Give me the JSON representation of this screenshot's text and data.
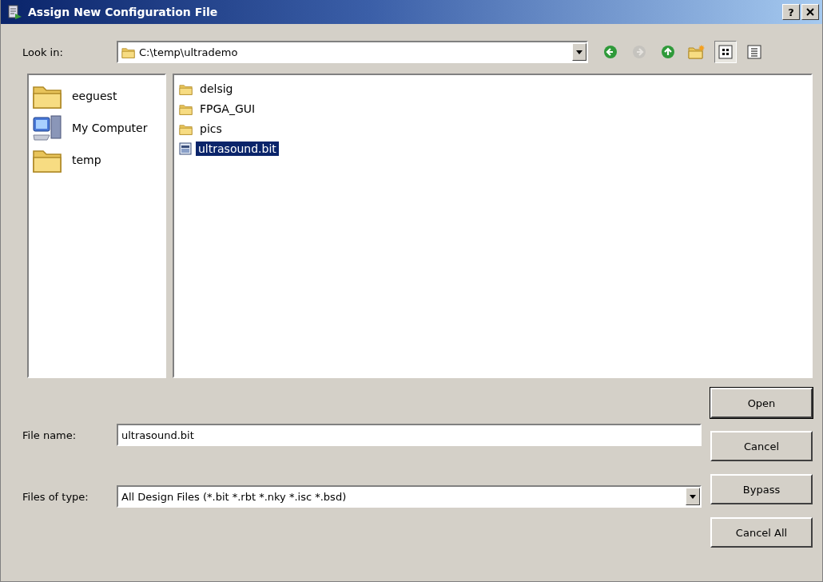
{
  "window": {
    "title": "Assign New Configuration File",
    "title_buttons": [
      {
        "kind": "help",
        "label": "?"
      },
      {
        "kind": "close"
      }
    ]
  },
  "look_in": {
    "label": "Look in:",
    "path": "C:\\temp\\ultrademo"
  },
  "toolbar": [
    {
      "kind": "back",
      "disabled": false,
      "selected": false
    },
    {
      "kind": "forward",
      "disabled": true,
      "selected": false
    },
    {
      "kind": "up",
      "disabled": false,
      "selected": false
    },
    {
      "kind": "new-folder",
      "disabled": false,
      "selected": false
    },
    {
      "kind": "list-view",
      "disabled": false,
      "selected": true
    },
    {
      "kind": "details-view",
      "disabled": false,
      "selected": false
    }
  ],
  "places": [
    {
      "label": "eeguest",
      "kind": "folder"
    },
    {
      "label": "My Computer",
      "kind": "computer"
    },
    {
      "label": "temp",
      "kind": "folder"
    }
  ],
  "files": [
    {
      "name": "delsig",
      "kind": "folder",
      "selected": false
    },
    {
      "name": "FPGA_GUI",
      "kind": "folder",
      "selected": false
    },
    {
      "name": "pics",
      "kind": "folder",
      "selected": false
    },
    {
      "name": "ultrasound.bit",
      "kind": "file",
      "selected": true
    }
  ],
  "file_name": {
    "label": "File name:",
    "value": "ultrasound.bit"
  },
  "file_type": {
    "label": "Files of type:",
    "value": "All Design Files (*.bit *.rbt *.nky *.isc *.bsd)"
  },
  "buttons": [
    "Open",
    "Cancel",
    "Bypass",
    "Cancel All"
  ]
}
